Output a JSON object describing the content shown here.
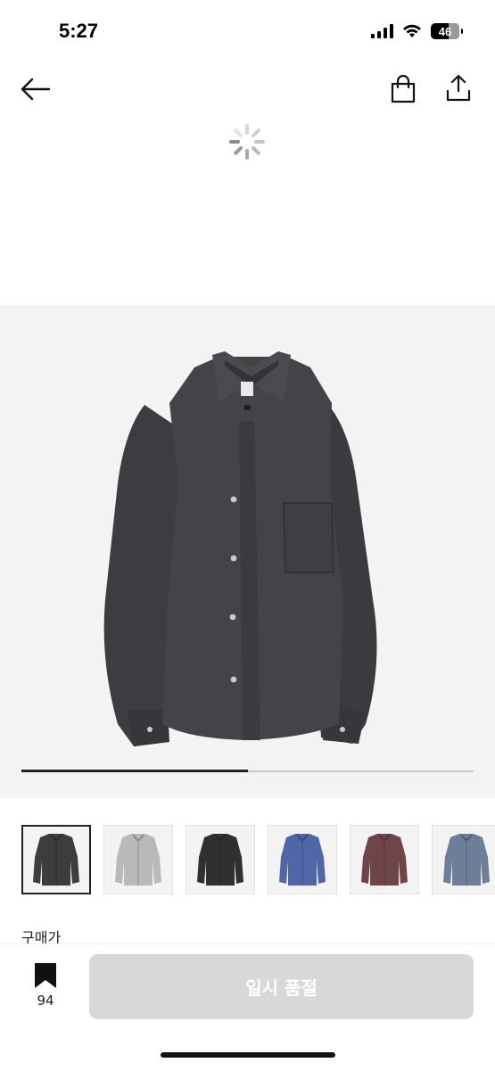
{
  "status_bar": {
    "time": "5:27",
    "battery": "46",
    "icons": [
      "signal-icon",
      "wifi-icon",
      "battery-icon"
    ]
  },
  "header": {
    "icons": [
      "back-arrow-icon",
      "shopping-bag-icon",
      "share-icon"
    ]
  },
  "gallery": {
    "progress": 0.5,
    "thumbnail_colors": [
      "#3b3d3f",
      "#b9b9bb",
      "#2e3032",
      "#4f67a6",
      "#6e4549",
      "#6d7f98"
    ],
    "selected_index": 0
  },
  "product": {
    "price_label": "구매가"
  },
  "bottom_bar": {
    "bookmark_count": "94",
    "soldout_label": "일시 품절"
  }
}
